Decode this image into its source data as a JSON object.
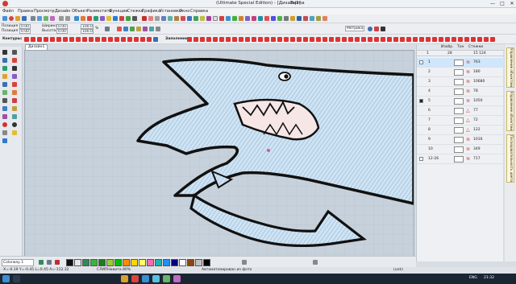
{
  "window": {
    "title": "(Ultimate Special Edition) - [Дизайн1]",
    "vendor": "Tajima",
    "min": "—",
    "max": "□",
    "close": "✕"
  },
  "menu": [
    "Файл",
    "Правка",
    "Просмотр",
    "Дизайн",
    "Объект",
    "Разместить",
    "Функции",
    "Стежки",
    "Графика",
    "Установки",
    "Окно",
    "Справка"
  ],
  "props": {
    "pos_x_label": "Позиция X:",
    "pos_x": "0.00",
    "pos_y_label": "Позиция Y:",
    "pos_y": "0.00",
    "width_label": "Ширина:",
    "width": "0.00",
    "height_label": "Высота:",
    "height": "0.00",
    "units": "мм",
    "pct": "100.00",
    "pct_unit": "%",
    "fill_label": "Заполнение:",
    "contour_label": "Контуры:",
    "zoom_select": "Метрика"
  },
  "doc_tab": "Дизайн1",
  "panel": {
    "headers": [
      "Изобр.",
      "Тон",
      "Стежки"
    ],
    "sub": [
      "1",
      "28",
      "15 124"
    ],
    "rows": [
      {
        "n": "1",
        "st": "763",
        "hl": true
      },
      {
        "n": "2",
        "st": "180",
        "hl": false
      },
      {
        "n": "3",
        "st": "10680",
        "hl": false
      },
      {
        "n": "4",
        "st": "78",
        "hl": false
      },
      {
        "n": "5",
        "st": "1050",
        "hl": false
      },
      {
        "n": "6",
        "st": "77",
        "hl": false
      },
      {
        "n": "7",
        "st": "72",
        "hl": false
      },
      {
        "n": "8",
        "st": "122",
        "hl": false
      },
      {
        "n": "9",
        "st": "1016",
        "hl": false
      },
      {
        "n": "10",
        "st": "349",
        "hl": false
      },
      {
        "n": "12-26",
        "st": "717",
        "hl": false
      }
    ],
    "side_tabs": [
      "Управление объектами",
      "Управление объектами",
      "Последовательность цветов"
    ]
  },
  "colorbar": {
    "label": "Colorway 1",
    "colors": [
      "#111111",
      "#e8e8e8",
      "#2e8b57",
      "#3cb43c",
      "#1f7a1f",
      "#9acd32",
      "#00c000",
      "#ff8c00",
      "#ffd700",
      "#ffff66",
      "#ff69b4",
      "#20b2aa",
      "#1e90ff",
      "#000080",
      "#ffffff",
      "#8b4513",
      "#c0c0c0",
      "#000000"
    ]
  },
  "status": {
    "coords": "X=-0.19 Y=-0.45 L=0.45 A=-112.32",
    "stitches": "СЛИПНикита 80%",
    "auto": "Автоматизирован из фото",
    "right": "(unk)"
  },
  "taskbar": {
    "time": "21:32",
    "lang": "ENG"
  }
}
